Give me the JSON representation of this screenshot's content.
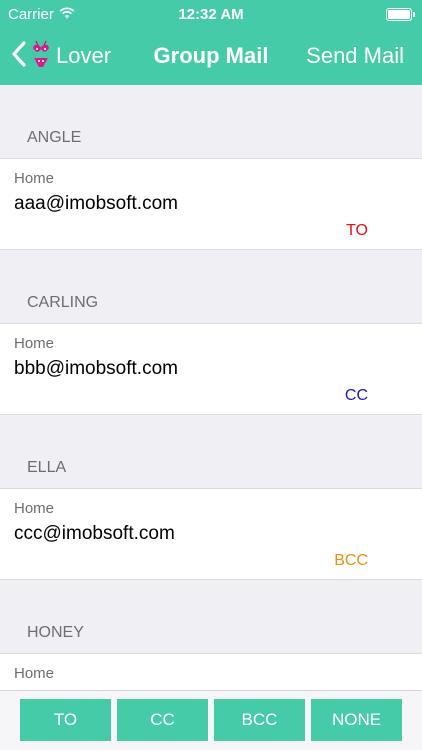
{
  "status_bar": {
    "carrier": "Carrier",
    "time": "12:32 AM",
    "battery_level": 1.0
  },
  "nav": {
    "back_label": "Lover",
    "back_icon": "chevron-left-icon",
    "back_emoji_icon": "bikini-icon",
    "title": "Group Mail",
    "action_label": "Send Mail"
  },
  "contacts": [
    {
      "name": "ANGLE",
      "type": "Home",
      "email": "aaa@imobsoft.com",
      "tag": "TO",
      "tag_color": "#e0141e"
    },
    {
      "name": "CARLING",
      "type": "Home",
      "email": "bbb@imobsoft.com",
      "tag": "CC",
      "tag_color": "#1a1ab8"
    },
    {
      "name": "ELLA",
      "type": "Home",
      "email": "ccc@imobsoft.com",
      "tag": "BCC",
      "tag_color": "#f08c14"
    },
    {
      "name": "HONEY",
      "type": "Home",
      "email": "",
      "tag": "",
      "tag_color": "#000000"
    }
  ],
  "toolbar": {
    "buttons": [
      "TO",
      "CC",
      "BCC",
      "NONE"
    ]
  },
  "colors": {
    "accent": "#45cba7",
    "background": "#efeff4"
  }
}
